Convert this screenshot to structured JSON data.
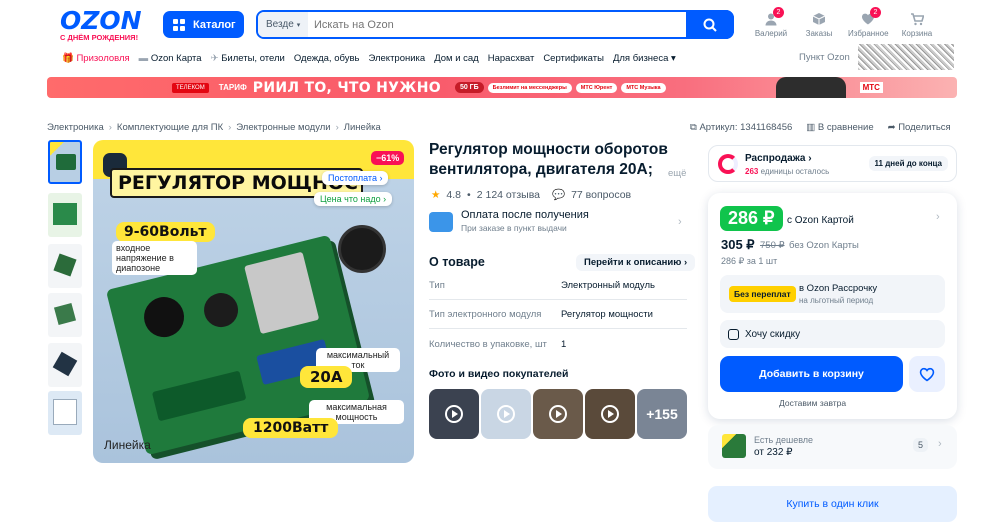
{
  "header": {
    "logo_text": "OZON",
    "logo_subtitle": "С ДНЁМ РОЖДЕНИЯ!",
    "catalog_label": "Каталог",
    "search_scope": "Везде",
    "search_placeholder": "Искать на Ozon",
    "icons": [
      {
        "name": "Валерий",
        "icon": "user-icon",
        "badge": "2"
      },
      {
        "name": "Заказы",
        "icon": "box-icon",
        "badge": ""
      },
      {
        "name": "Избранное",
        "icon": "heart-icon",
        "badge": "2"
      },
      {
        "name": "Корзина",
        "icon": "cart-icon",
        "badge": ""
      }
    ]
  },
  "nav": {
    "items": [
      "Призоловля",
      "Ozon Карта",
      "Билеты, отели",
      "Одежда, обувь",
      "Электроника",
      "Дом и сад",
      "Нарасхват",
      "Сертификаты",
      "Для бизнеса"
    ],
    "pickup": "Пункт Ozon"
  },
  "banner": {
    "brand": "ТЕЛЕКОМ",
    "tariff": "ТАРИФ",
    "slogan": "РИИЛ ТО, ЧТО НУЖНО",
    "gb": "50 ГБ",
    "chip1": "Безлимит на мессенджеры",
    "chip2": "МТС Юрент",
    "chip3": "МТС Музыка",
    "logo": "МТС"
  },
  "breadcrumbs": [
    "Электроника",
    "Комплектующие для ПК",
    "Электронные модули",
    "Линейка"
  ],
  "actions": {
    "article": "Артикул: 1341168456",
    "compare": "В сравнение",
    "share": "Поделиться"
  },
  "image": {
    "discount": "−61%",
    "postpay": "Постоплата",
    "price_good": "Цена что надо",
    "headline": "РЕГУЛЯТОР МОЩНОСТИ",
    "volts": "9-60Вольт",
    "range_note": "входное напряжение в диапозоне",
    "max_current_note": "максимальный ток",
    "current": "20А",
    "max_power_note": "максимальная мощность",
    "power": "1200Ватт",
    "brand": "Линейка"
  },
  "product": {
    "title": "Регулятор мощности оборотов вентилятора, двигателя 20А;",
    "more": "ещё",
    "rating": "4.8",
    "reviews": "2 124 отзыва",
    "questions": "77 вопросов",
    "payment_title": "Оплата после получения",
    "payment_sub": "При заказе в пункт выдачи",
    "about_title": "О товаре",
    "to_description": "Перейти к описанию",
    "specs": [
      {
        "key": "Тип",
        "value": "Электронный модуль"
      },
      {
        "key": "Тип электронного модуля",
        "value": "Регулятор мощности"
      },
      {
        "key": "Количество в упаковке, шт",
        "value": "1"
      }
    ],
    "photos_title": "Фото и видео покупателей",
    "photos_more": "+155"
  },
  "price": {
    "sale_label": "Распродажа",
    "sale_units": "263",
    "sale_units_text": "единицы осталось",
    "sale_days": "11 дней до конца",
    "card_price": "286 ₽",
    "card_label": "с Ozon Картой",
    "regular_price": "305 ₽",
    "old_price": "750 ₽",
    "regular_label": "без Ozon Карты",
    "unit_price": "286 ₽",
    "unit_label": "за 1 шт",
    "installment_badge": "Без переплат",
    "installment_title": "в Ozon Рассрочку",
    "installment_sub": "на льготный период",
    "want_discount": "Хочу скидку",
    "add_to_cart": "Добавить в корзину",
    "delivery": "Доставим завтра",
    "cheaper_label": "Есть дешевле",
    "cheaper_price": "от 232 ₽",
    "cheaper_count": "5",
    "one_click": "Купить в один клик"
  }
}
